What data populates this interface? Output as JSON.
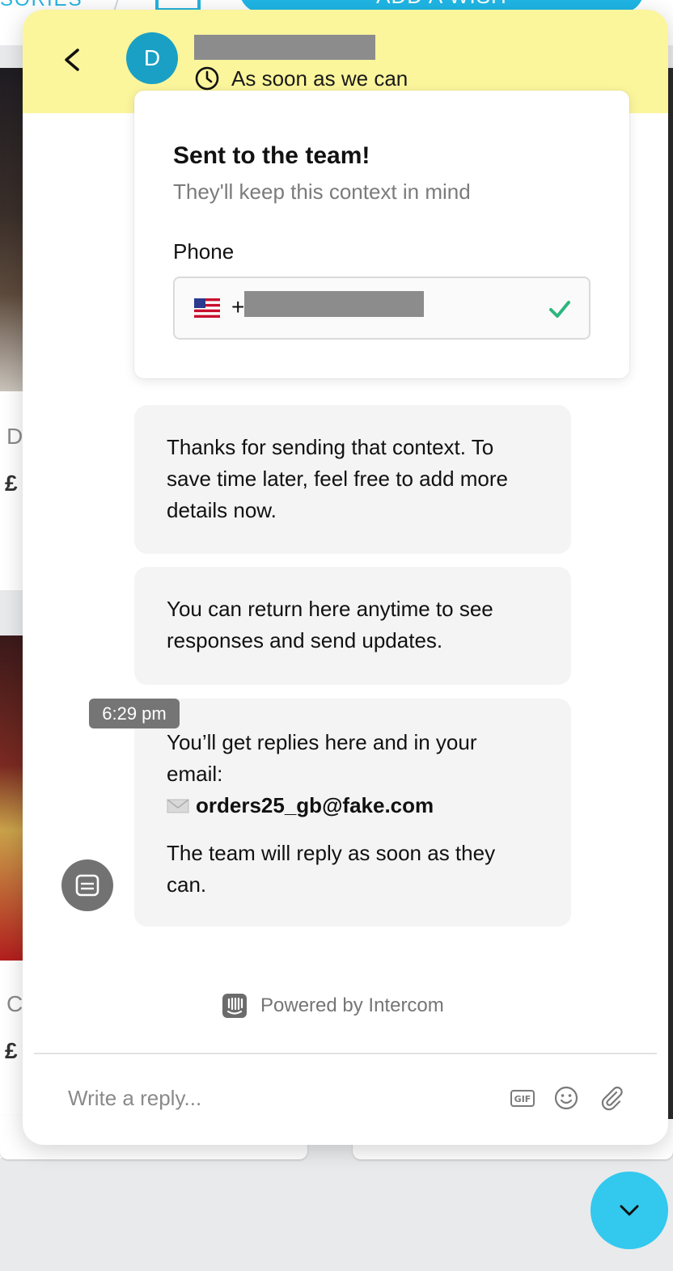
{
  "background": {
    "category_text": "SORIES",
    "wish_button_label": "ADD A WISH",
    "card_letters": [
      "D",
      "C"
    ],
    "card_prices": [
      "£",
      "£"
    ]
  },
  "header": {
    "avatar_initial": "D",
    "response_time": "As soon as we can",
    "icons": [
      "back-arrow-icon",
      "clock-icon"
    ]
  },
  "confirmation_card": {
    "title": "Sent to the team!",
    "subtitle": "They'll keep this context in mind",
    "phone_label": "Phone",
    "phone_prefix": "+",
    "country": "US",
    "verified_icon": "check-icon"
  },
  "messages": [
    {
      "text": "Thanks for sending that context. To save time later, feel free to add more details now."
    },
    {
      "text": "You can return here anytime to see responses and send updates."
    },
    {
      "line1": "You’ll get replies here and in your email:",
      "email": "orders25_gb@fake.com",
      "line2": "The team will reply as soon as they can."
    }
  ],
  "timestamp": "6:29 pm",
  "footer": {
    "powered_by": "Powered by Intercom"
  },
  "composer": {
    "placeholder": "Write a reply...",
    "icons": [
      "gif-icon",
      "emoji-icon",
      "attachment-icon"
    ]
  },
  "colors": {
    "header_bg": "#fbf59c",
    "avatar_bg": "#1aa0c4",
    "bubble_bg": "#f4f4f4",
    "check_green": "#2cb67d",
    "launcher_bg": "#33c8ee",
    "accent_blue": "#1fb6e6"
  }
}
